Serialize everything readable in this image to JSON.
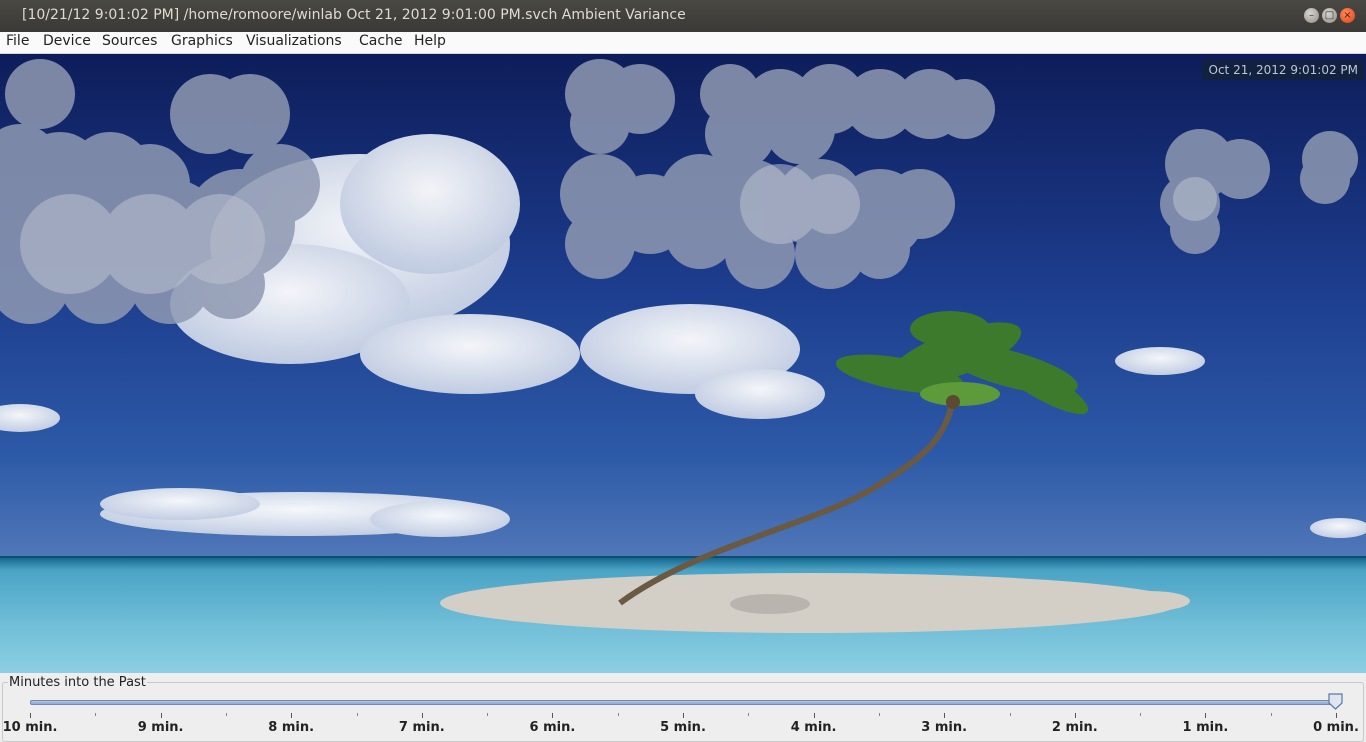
{
  "window": {
    "title": "[10/21/12 9:01:02 PM] /home/romoore/winlab Oct 21, 2012 9:01:00 PM.svch Ambient Variance",
    "controls": [
      "minimize-icon",
      "maximize-icon",
      "close-icon"
    ]
  },
  "menubar": {
    "items": [
      "File",
      "Device",
      "Sources",
      "Graphics",
      "Visualizations",
      "Cache",
      "Help"
    ]
  },
  "scene": {
    "timestamp": "Oct 21, 2012 9:01:02 PM",
    "colors": {
      "sky_top": "#0e1d5a",
      "sky_mid": "#2452a6",
      "sea": "#5fb4cf",
      "sand": "#cfc9c0",
      "bubble": "#8f99b2"
    }
  },
  "slider": {
    "title": "Minutes into the Past",
    "value": 0,
    "min": 0,
    "max": 10,
    "labels": [
      "10 min.",
      "9 min.",
      "8 min.",
      "7 min.",
      "6 min.",
      "5 min.",
      "4 min.",
      "3 min.",
      "2 min.",
      "1 min.",
      "0 min."
    ]
  }
}
